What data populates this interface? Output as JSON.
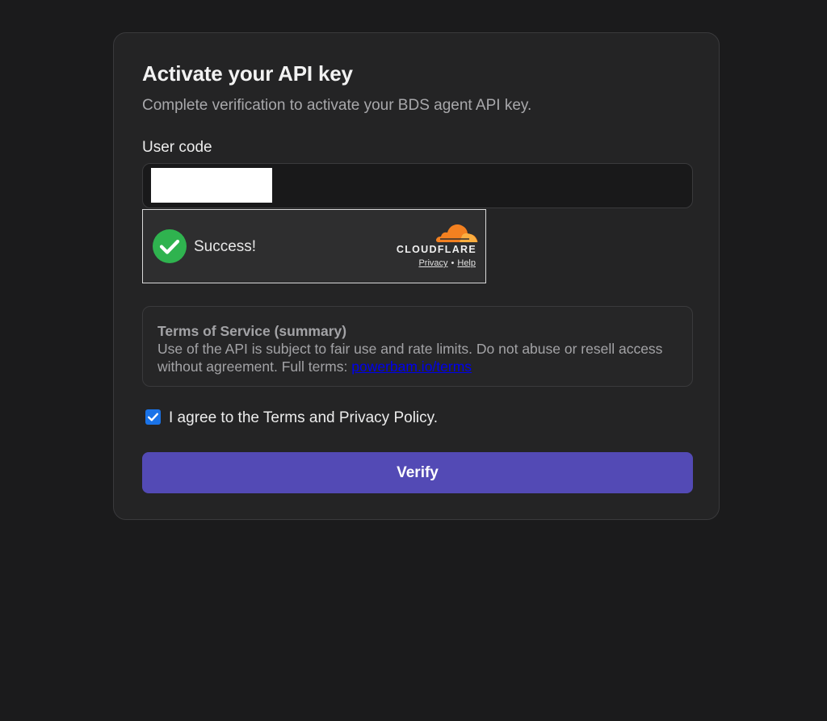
{
  "card": {
    "title": "Activate your API key",
    "subtitle": "Complete verification to activate your BDS agent API key."
  },
  "user_code": {
    "label": "User code",
    "value": ""
  },
  "turnstile": {
    "status": "Success!",
    "brand": "CLOUDFLARE",
    "privacy_link": "Privacy",
    "separator": "•",
    "help_link": "Help",
    "check_icon": "check-circle-icon",
    "logo_icon": "cloudflare-cloud-icon"
  },
  "tos": {
    "title": "Terms of Service (summary)",
    "body": "Use of the API is subject to fair use and rate limits. Do not abuse or resell access without agreement. Full terms: ",
    "link_text": "powerbam.io/terms"
  },
  "agreement": {
    "label": "I agree to the Terms and Privacy Policy.",
    "checked": true
  },
  "verify_button": {
    "label": "Verify"
  },
  "colors": {
    "background": "#1b1b1c",
    "card": "#242425",
    "accent": "#534ab5",
    "success": "#2fb34f",
    "cloudflare_orange": "#f38020",
    "checkbox": "#1a73e8"
  }
}
